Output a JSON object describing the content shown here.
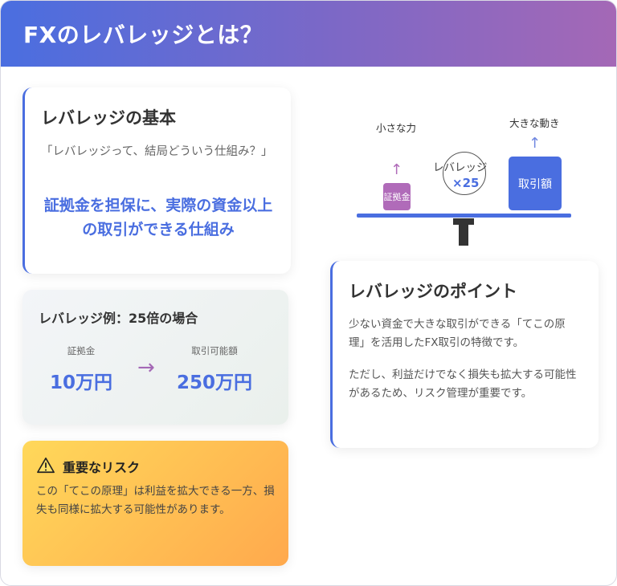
{
  "header": {
    "title": "FXのレバレッジとは？"
  },
  "basics": {
    "title": "レバレッジの基本",
    "quote": "「レバレッジって、結局どういう仕組み？」",
    "highlight": "証拠金を担保に、実際の資金以上の取引ができる仕組み"
  },
  "example": {
    "title": "レバレッジ例：25倍の場合",
    "margin_label": "証拠金",
    "margin_value": "10万円",
    "arrow": "→",
    "tradable_label": "取引可能額",
    "tradable_value": "250万円"
  },
  "risk": {
    "icon": "warning-triangle-icon",
    "title": "重要なリスク",
    "body": "この「てこの原理」は利益を拡大できる一方、損失も同様に拡大する可能性があります。"
  },
  "diagram": {
    "small_force_label": "小さな力",
    "big_move_label": "大きな動き",
    "margin_box": "証拠金",
    "trade_box": "取引額",
    "leverage_name": "レバレッジ",
    "leverage_multiplier": "×25",
    "up_arrow": "↑"
  },
  "points": {
    "title": "レバレッジのポイント",
    "p1": "少ない資金で大きな取引ができる「てこの原理」を活用したFX取引の特徴です。",
    "p2": "ただし、利益だけでなく損失も拡大する可能性があるため、リスク管理が重要です。"
  },
  "colors": {
    "accent_blue": "#4a6ee0",
    "accent_purple": "#a468b6",
    "risk_yellow": "#ffd85a",
    "risk_orange": "#ffa94d"
  }
}
